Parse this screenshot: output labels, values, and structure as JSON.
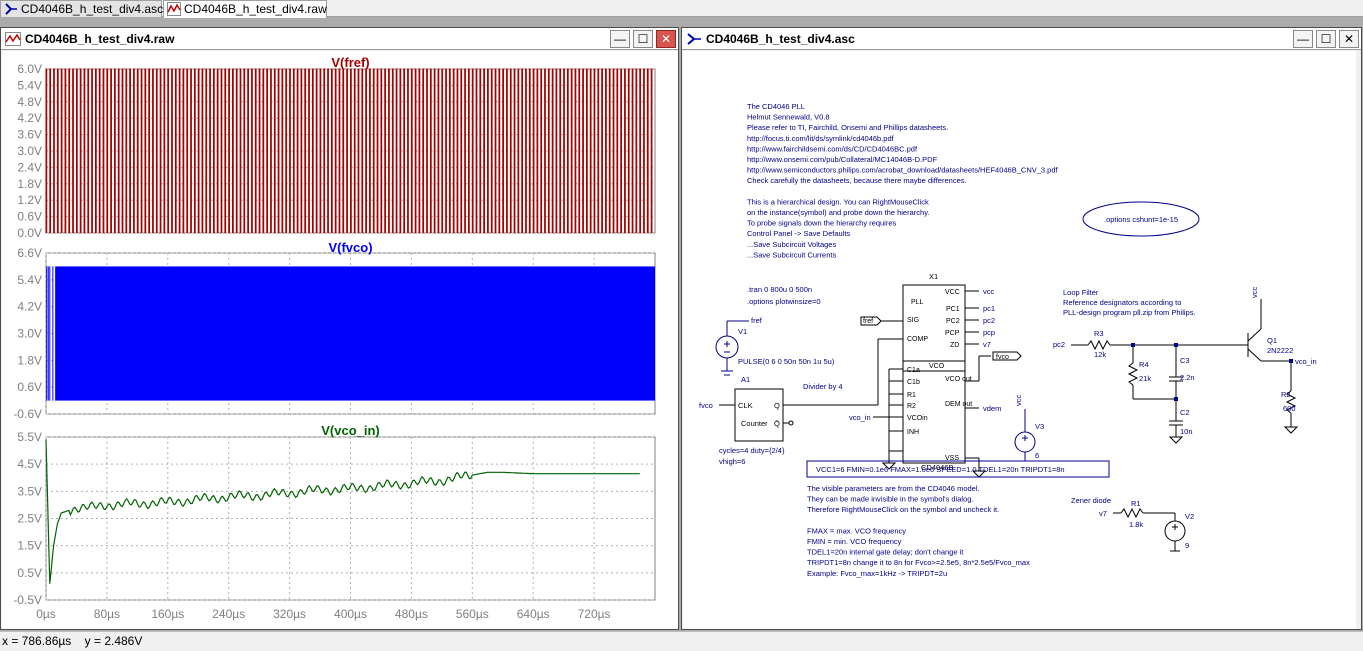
{
  "tabs": [
    {
      "label": "CD4046B_h_test_div4.asc"
    },
    {
      "label": "CD4046B_h_test_div4.raw"
    }
  ],
  "plot_window": {
    "title": "CD4046B_h_test_div4.raw",
    "buttons": {
      "minimize": "—",
      "maximize": "☐",
      "close": "✕"
    }
  },
  "schematic_window": {
    "title": "CD4046B_h_test_div4.asc",
    "buttons": {
      "minimize": "—",
      "maximize": "☐",
      "close": "✕"
    }
  },
  "chart_data": [
    {
      "type": "line",
      "title": "V(fref)",
      "color": "#a50000",
      "yticks": [
        "6.0V",
        "5.4V",
        "4.8V",
        "4.2V",
        "3.6V",
        "3.0V",
        "2.4V",
        "1.8V",
        "1.2V",
        "0.6V",
        "0.0V"
      ],
      "ylim": [
        0,
        6.0
      ],
      "description_values": {
        "low": 0,
        "high": 6.0,
        "waveform": "square"
      }
    },
    {
      "type": "line",
      "title": "V(fvco)",
      "color": "#0000ff",
      "yticks": [
        "6.6V",
        "5.4V",
        "4.2V",
        "3.0V",
        "1.8V",
        "0.6V",
        "-0.6V"
      ],
      "ylim": [
        -0.6,
        6.6
      ],
      "description_values": {
        "low": 0,
        "high": 6.0,
        "waveform": "square"
      }
    },
    {
      "type": "line",
      "title": "V(vco_in)",
      "color": "#006400",
      "yticks": [
        "5.5V",
        "4.5V",
        "3.5V",
        "2.5V",
        "1.5V",
        "0.5V",
        "-0.5V"
      ],
      "ylim": [
        -0.5,
        5.5
      ],
      "x": [
        0,
        5,
        10,
        15,
        20,
        30,
        40,
        60,
        80,
        120,
        160,
        200,
        240,
        280,
        320,
        360,
        400,
        440,
        480,
        520,
        560,
        580,
        600,
        640,
        680,
        720,
        780
      ],
      "y": [
        5.4,
        0.1,
        1.5,
        2.3,
        2.7,
        2.8,
        2.9,
        2.9,
        3.0,
        3.05,
        3.1,
        3.2,
        3.3,
        3.35,
        3.45,
        3.55,
        3.6,
        3.7,
        3.8,
        3.9,
        4.1,
        4.2,
        4.2,
        4.15,
        4.15,
        4.15,
        4.15
      ]
    }
  ],
  "xaxis": {
    "ticks": [
      "0µs",
      "80µs",
      "160µs",
      "240µs",
      "320µs",
      "400µs",
      "480µs",
      "560µs",
      "640µs",
      "720µs"
    ],
    "tick_values": [
      0,
      80,
      160,
      240,
      320,
      400,
      480,
      560,
      640,
      720
    ],
    "xlim": [
      0,
      800
    ]
  },
  "schematic": {
    "header_notes": [
      "The CD4046 PLL",
      "Helmut Sennewald, V0.8",
      "Please refer to TI, Fairchild, Onsemi and  Phillips datasheets.",
      "http://focus.ti.com/lit/ds/symlink/cd4046b.pdf",
      "http://www.fairchildsemi.com/ds/CD/CD4046BC.pdf",
      "http://www.onsemi.com/pub/Collateral/MC14046B-D.PDF",
      "http://www.semiconductors.philips.com/acrobat_download/datasheets/HEF4046B_CNV_3.pdf",
      "Check carefully the datasheets, because there maybe differences.",
      "",
      "This is a hierarchical design. You can RightMouseClick",
      "on the instance(symbol) and probe down the hierarchy.",
      "To probe signals down the hierarchy requires",
      "Control Panel -> Save Defaults",
      "...Save Subcircuit Voltages",
      "...Save Subcircuit Currents"
    ],
    "options_ellipse": ".options cshunt=1e-15",
    "tran": ".tran 0 800u 0 500n",
    "plotwinsize": ".options plotwinsize=0",
    "v1_label": "V1",
    "v1_value": "PULSE(0 6 0 50n 50n 1u 5u)",
    "fref": "fref",
    "fvco": "fvco",
    "a1": "A1",
    "divider": "Divider by 4",
    "counter": "Counter",
    "clk": "CLK",
    "q": "Q",
    "qbar": "Q̄",
    "cycles": "cycles=4 duty={2/4}",
    "vhigh": "vhigh=6",
    "x1": "X1",
    "ic_name": "CD4046B",
    "pins_left": [
      "PLL",
      "SIG",
      "COMP",
      "C1a",
      "C1b",
      "R1",
      "R2",
      "VCOin",
      "INH"
    ],
    "pins_right": [
      "VCC",
      "PC1",
      "PC2",
      "PCP",
      "ZD",
      "VCO out",
      "DEM out",
      "VSS"
    ],
    "vco_label": "VCO",
    "nets_right": [
      "vcc",
      "pc1",
      "pc2",
      "pcp",
      "v7"
    ],
    "vcc": "vcc",
    "vdem": "vdem",
    "vco_in": "vco_in",
    "v3": "V3",
    "v3_val": "6",
    "loop_filter": [
      "Loop Filter",
      "Reference designators according to",
      "PLL-design program pll.zip from Philips."
    ],
    "r3": "R3",
    "r3_val": "12k",
    "r4": "R4",
    "r4_val": "21k",
    "c3": "C3",
    "c3_val": "2.2n",
    "c2": "C2",
    "c2_val": "10n",
    "pc2": "pc2",
    "q1": "Q1",
    "q1_val": "2N2222",
    "r2": "R2",
    "r2_val": "600",
    "params": "VCC1=6 FMIN=0.1e6 FMAX=1.0e6 SPEED=1.0 TDEL1=20n TRIPDT1=8n",
    "notes2": [
      "The visible parameters are from the CD4046 model.",
      "They can be made invisible in the symbol's dialog.",
      "Therefore RightMouseClick on the symbol and uncheck it.",
      "",
      "FMAX = max. VCO frequency",
      "FMIN = min. VCO frequency",
      "TDEL1=20n  internal gate delay; don't change it",
      "TRIPDT1=8n  change it to 8n for Fvco>=2.5e5, 8n*2.5e5/Fvco_max",
      "Example:  Fvco_max=1kHz -> TRIPDT=2u"
    ],
    "zener": "Zener diode",
    "r1": "R1",
    "r1_val": "1.8k",
    "v7": "v7",
    "v2": "V2",
    "v2_val": "9"
  },
  "status": {
    "x": "x = 786.86µs",
    "y": "y = 2.486V"
  }
}
